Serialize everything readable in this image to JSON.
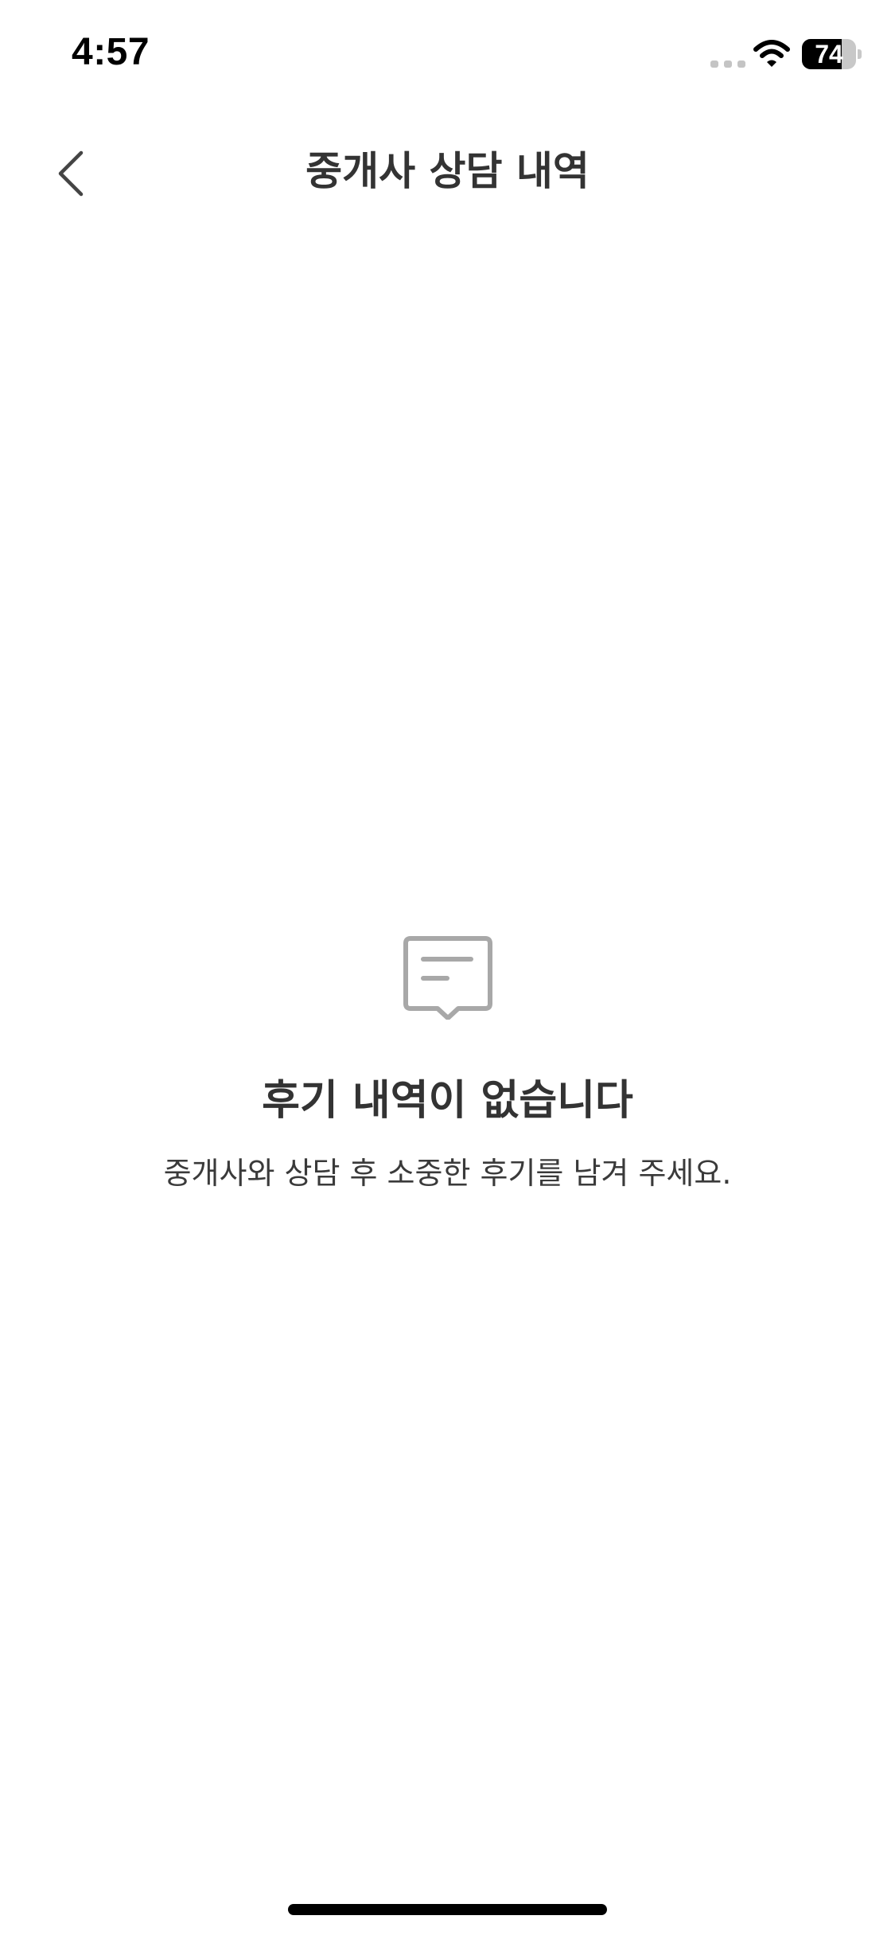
{
  "status_bar": {
    "time": "4:57",
    "battery_level": "74",
    "battery_fraction": 0.74,
    "icons": [
      "signal-icon",
      "wifi-icon",
      "battery-icon"
    ]
  },
  "header": {
    "title": "중개사 상담 내역",
    "back_icon": "chevron-left-icon"
  },
  "empty_state": {
    "icon": "message-bubble-icon",
    "title": "후기 내역이 없습니다",
    "description": "중개사와 상담 후 소중한 후기를 남겨 주세요."
  },
  "colors": {
    "text_primary": "#333333",
    "icon_gray": "#a8a8a8",
    "background": "#ffffff"
  }
}
